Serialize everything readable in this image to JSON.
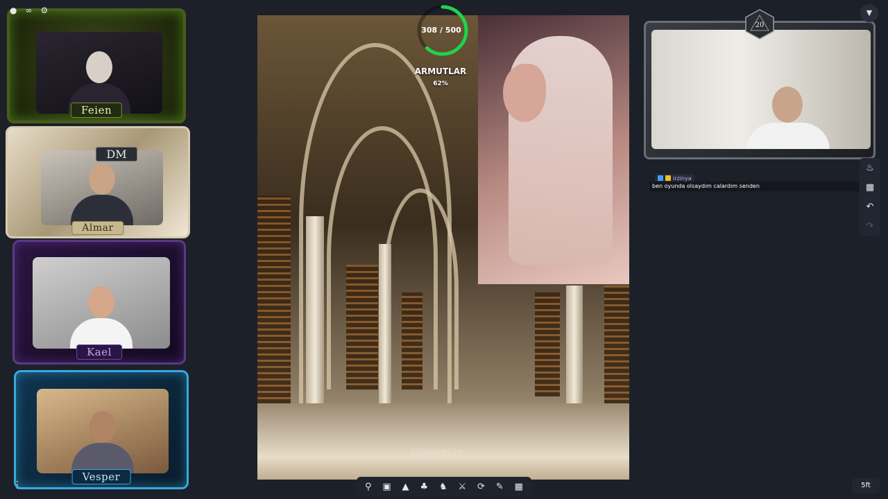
{
  "players": [
    {
      "name": "Feien"
    },
    {
      "name": "Almar"
    },
    {
      "name": "Kael"
    },
    {
      "name": "Vesper"
    }
  ],
  "dm": {
    "label": "DM",
    "dice_value": "20"
  },
  "progress": {
    "current": 308,
    "max": 500,
    "text": "308 / 500",
    "name": "ARMUTLAR",
    "percent_label": "62%",
    "color": "#22d34a"
  },
  "scene": {
    "watermark": "ptoloverse"
  },
  "chat": {
    "username": "irzinya",
    "message": "ben oyunda olsaydım calardım senden"
  },
  "map_scale": "5ft",
  "icons": {
    "top": [
      "user-icon",
      "group-icon",
      "settings-icon"
    ],
    "bottom": [
      "search-icon",
      "image-icon",
      "mountain-icon",
      "tree-icon",
      "horse-icon",
      "sword-icon",
      "refresh-icon",
      "note-icon",
      "grid-icon"
    ],
    "side": [
      "flame-icon",
      "layers-icon",
      "undo-icon",
      "redo-icon"
    ]
  }
}
